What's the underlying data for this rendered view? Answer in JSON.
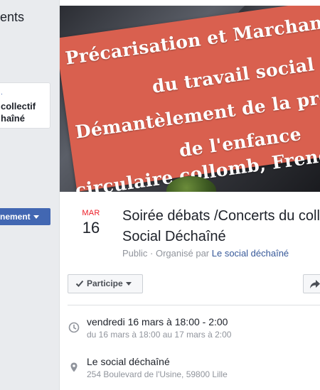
{
  "left": {
    "heading": "ents",
    "card_prefix": ".",
    "card_name_line1": "collectif",
    "card_name_line2": "haîné",
    "button_label": "nement"
  },
  "cover": {
    "lines": [
      "Précarisation et Marchand",
      "du travail social",
      "Démantèlement de la pro",
      "de l'enfance",
      "circulaire collomb, Frenc"
    ]
  },
  "event": {
    "month": "MAR",
    "day": "16",
    "title_line1": "Soirée débats /Concerts du colle",
    "title_line2": "Social Déchaîné",
    "privacy": "Public",
    "organized_by": " · Organisé par ",
    "organizer": "Le social déchaîné"
  },
  "actions": {
    "participe_label": "Participe"
  },
  "details": {
    "datetime_main": "vendredi 16 mars à 18:00 - 2:00",
    "datetime_sub": "du 16 mars à 18:00 au 17 mars à 2:00",
    "place_name": "Le social déchaîné",
    "place_address": "254 Boulevard de l'Usine, 59800 Lille"
  },
  "colors": {
    "accent": "#4267b2",
    "link": "#365899",
    "month_red": "#ec1b24",
    "banner": "#d9604f"
  }
}
